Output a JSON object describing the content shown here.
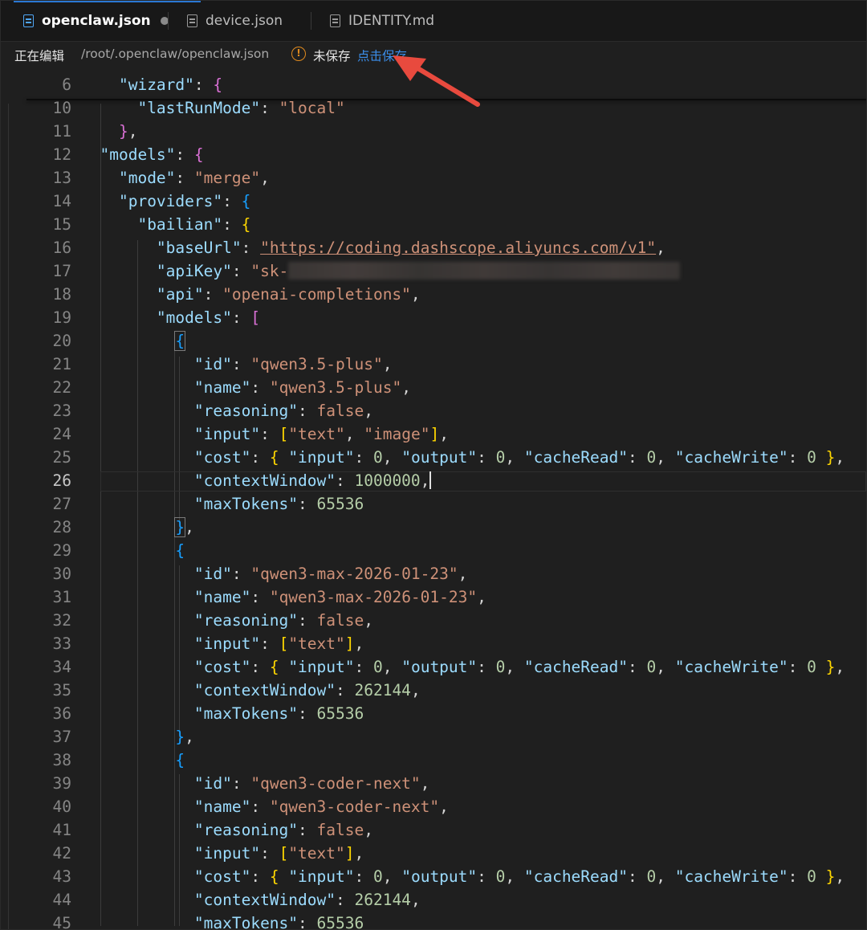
{
  "tabs": [
    {
      "label": "openclaw.json",
      "active": true,
      "modified": true
    },
    {
      "label": "device.json",
      "active": false,
      "modified": false
    },
    {
      "label": "IDENTITY.md",
      "active": false,
      "modified": false
    }
  ],
  "status": {
    "editing_label": "正在编辑",
    "file_path": "/root/.openclaw/openclaw.json",
    "warn_glyph": "!",
    "unsaved_label": "未保存",
    "save_link": "点击保存"
  },
  "editor": {
    "current_line": 26,
    "line_numbers": [
      "6",
      "10",
      "11",
      "12",
      "13",
      "14",
      "15",
      "16",
      "17",
      "18",
      "19",
      "20",
      "21",
      "22",
      "23",
      "24",
      "25",
      "26",
      "27",
      "28",
      "29",
      "30",
      "31",
      "32",
      "33",
      "34",
      "35",
      "36",
      "37",
      "38",
      "39",
      "40",
      "41",
      "42",
      "43",
      "44",
      "45"
    ],
    "code": {
      "l6_key": "\"wizard\"",
      "l10_key": "\"lastRunMode\"",
      "l10_val": "\"local\"",
      "l12_key": "\"models\"",
      "l13_key": "\"mode\"",
      "l13_val": "\"merge\"",
      "l14_key": "\"providers\"",
      "l15_key": "\"bailian\"",
      "l16_key": "\"baseUrl\"",
      "l16_val": "\"https://coding.dashscope.aliyuncs.com/v1\"",
      "l17_key": "\"apiKey\"",
      "l17_val": "\"sk-",
      "l18_key": "\"api\"",
      "l18_val": "\"openai-completions\"",
      "l19_key": "\"models\"",
      "m1_id": "\"qwen3.5-plus\"",
      "m1_name": "\"qwen3.5-plus\"",
      "m1_ctx": "1000000",
      "m2_id": "\"qwen3-max-2026-01-23\"",
      "m2_name": "\"qwen3-max-2026-01-23\"",
      "m2_ctx": "262144",
      "m3_id": "\"qwen3-coder-next\"",
      "m3_name": "\"qwen3-coder-next\"",
      "m3_ctx": "262144",
      "k_id": "\"id\"",
      "k_name": "\"name\"",
      "k_reasoning": "\"reasoning\"",
      "k_input": "\"input\"",
      "k_cost": "\"cost\"",
      "k_ctx": "\"contextWindow\"",
      "k_max": "\"maxTokens\"",
      "k_output": "\"output\"",
      "k_cacheRead": "\"cacheRead\"",
      "k_cacheWrite": "\"cacheWrite\"",
      "v_false": "false",
      "v_zero": "0",
      "v_max": "65536",
      "v_text": "\"text\"",
      "v_image": "\"image\""
    }
  },
  "colors": {
    "key": "#9cdcfe",
    "string": "#ce9178",
    "number": "#b5cea8",
    "keyword": "#569cd6",
    "link": "#3b8eea",
    "warning": "#e08a1e",
    "arrow": "#e84a3e"
  }
}
